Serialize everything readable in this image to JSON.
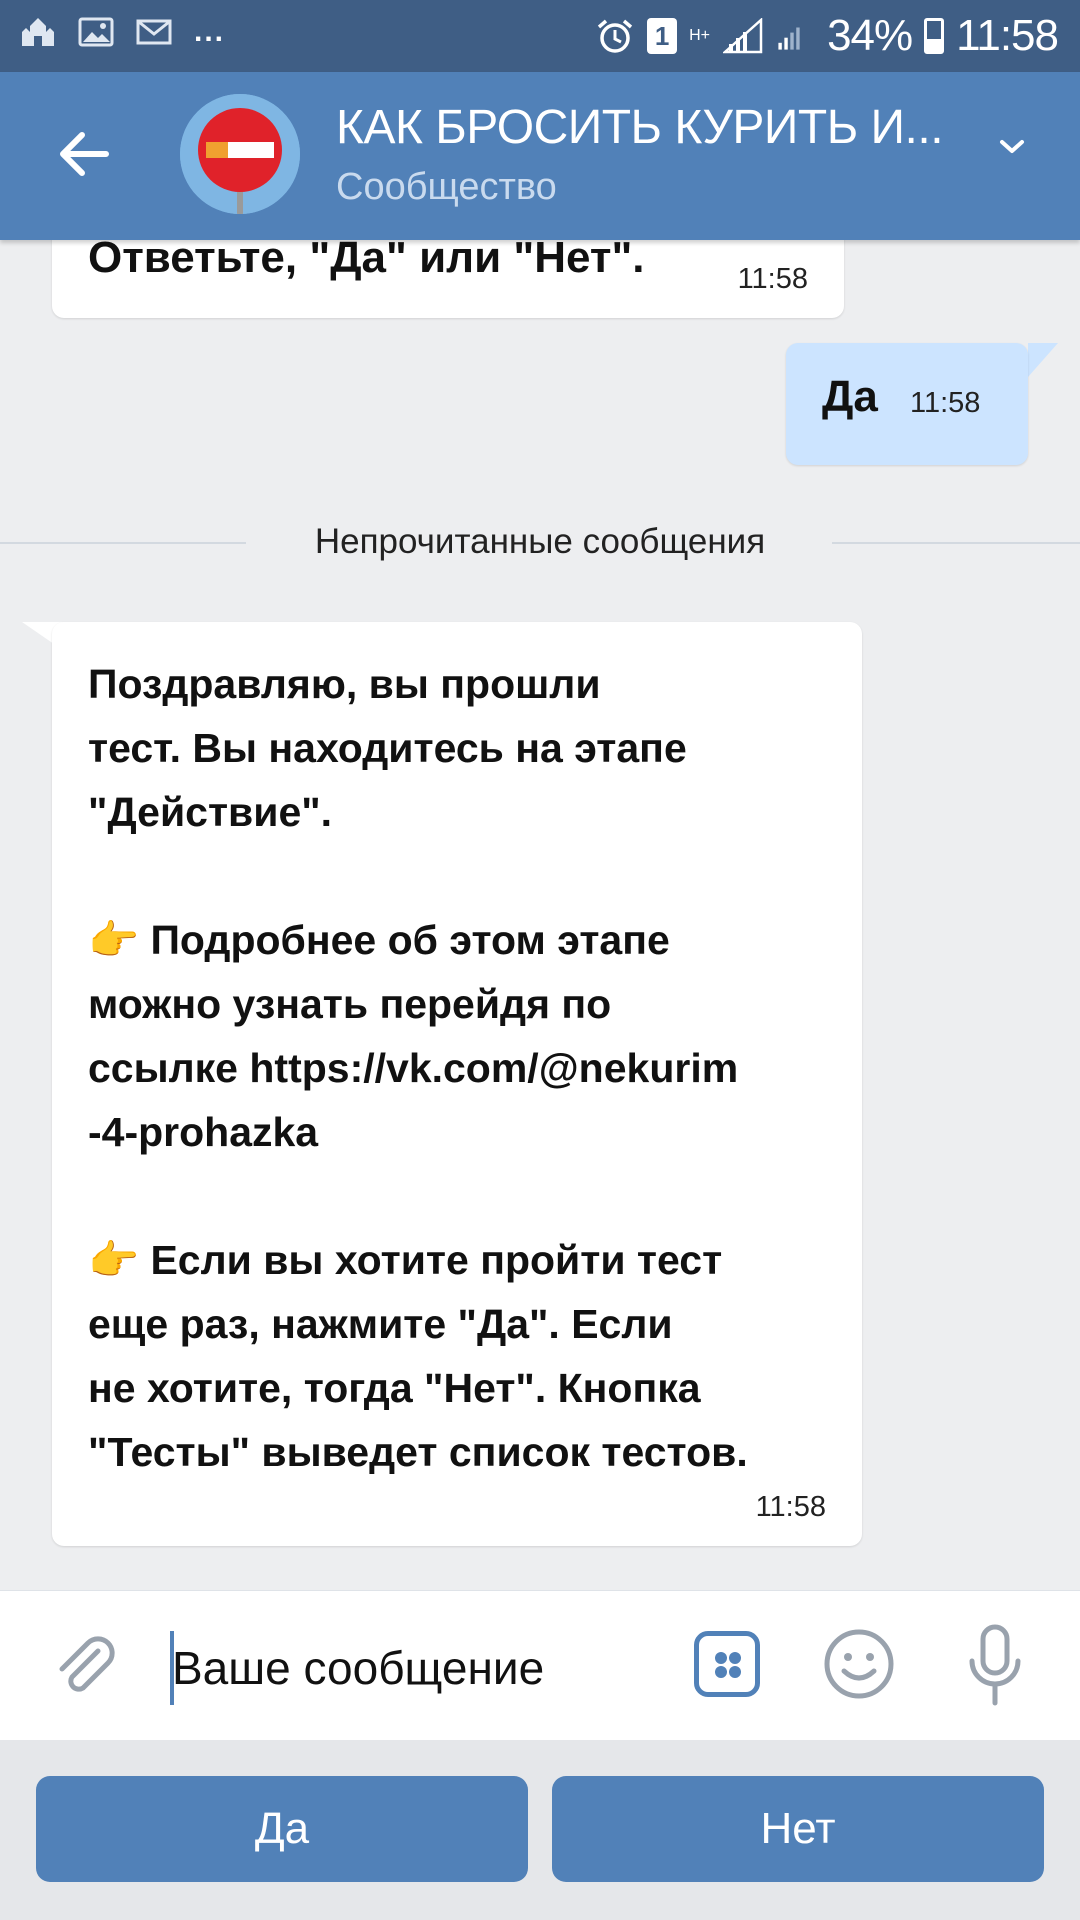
{
  "status_bar": {
    "battery": "34%",
    "time": "11:58",
    "sim_badge": "1",
    "network": "H+",
    "more": "..."
  },
  "header": {
    "title": "КАК БРОСИТЬ КУРИТЬ И...",
    "subtitle": "Сообщество"
  },
  "messages": [
    {
      "text": "Ответьте, \"Да\" или \"Нет\".",
      "time": "11:58"
    },
    {
      "text": "Да",
      "time": "11:58"
    },
    {
      "text": "Поздравляю, вы прошли\nтест. Вы находитесь на этапе\n\"Действие\".\n\n👉 Подробнее об этом этапе\nможно узнать перейдя по\nссылке https://vk.com/@nekurim\n-4-prohazka\n\n👉 Если вы хотите пройти тест\nеще раз, нажмите \"Да\". Если\nне хотите, тогда \"Нет\". Кнопка\n\"Тесты\" выведет список тестов.",
      "time": "11:58"
    }
  ],
  "unread_divider": "Непрочитанные сообщения",
  "composer": {
    "placeholder": "Ваше сообщение"
  },
  "keyboard": {
    "buttons": [
      "Да",
      "Нет"
    ]
  },
  "colors": {
    "status_bar": "#3f5e85",
    "header": "#5181b8",
    "chat_bg": "#edeef0",
    "outgoing_bubble": "#cce4ff",
    "accent": "#5181b8"
  }
}
